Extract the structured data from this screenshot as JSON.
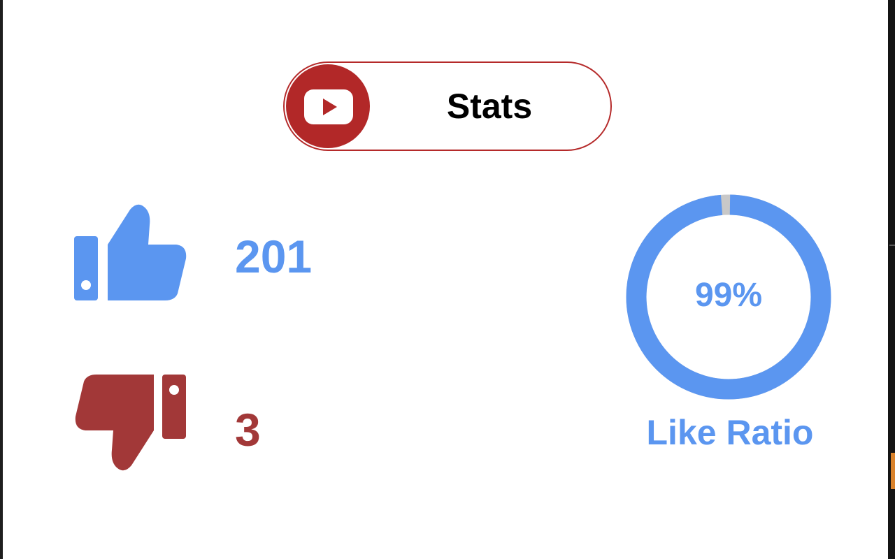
{
  "header": {
    "title": "Stats",
    "icon": "youtube-play-icon"
  },
  "stats": {
    "likes": {
      "value": "201",
      "icon": "thumbs-up-icon"
    },
    "dislikes": {
      "value": "3",
      "icon": "thumbs-down-icon"
    }
  },
  "ratio": {
    "percent_label": "99%",
    "fraction": 0.99,
    "label": "Like Ratio"
  },
  "colors": {
    "like": "#5b96f0",
    "dislike": "#a23838",
    "accent_red": "#b22828",
    "ring_remainder": "#c8c8c8",
    "title_text": "#000000"
  }
}
